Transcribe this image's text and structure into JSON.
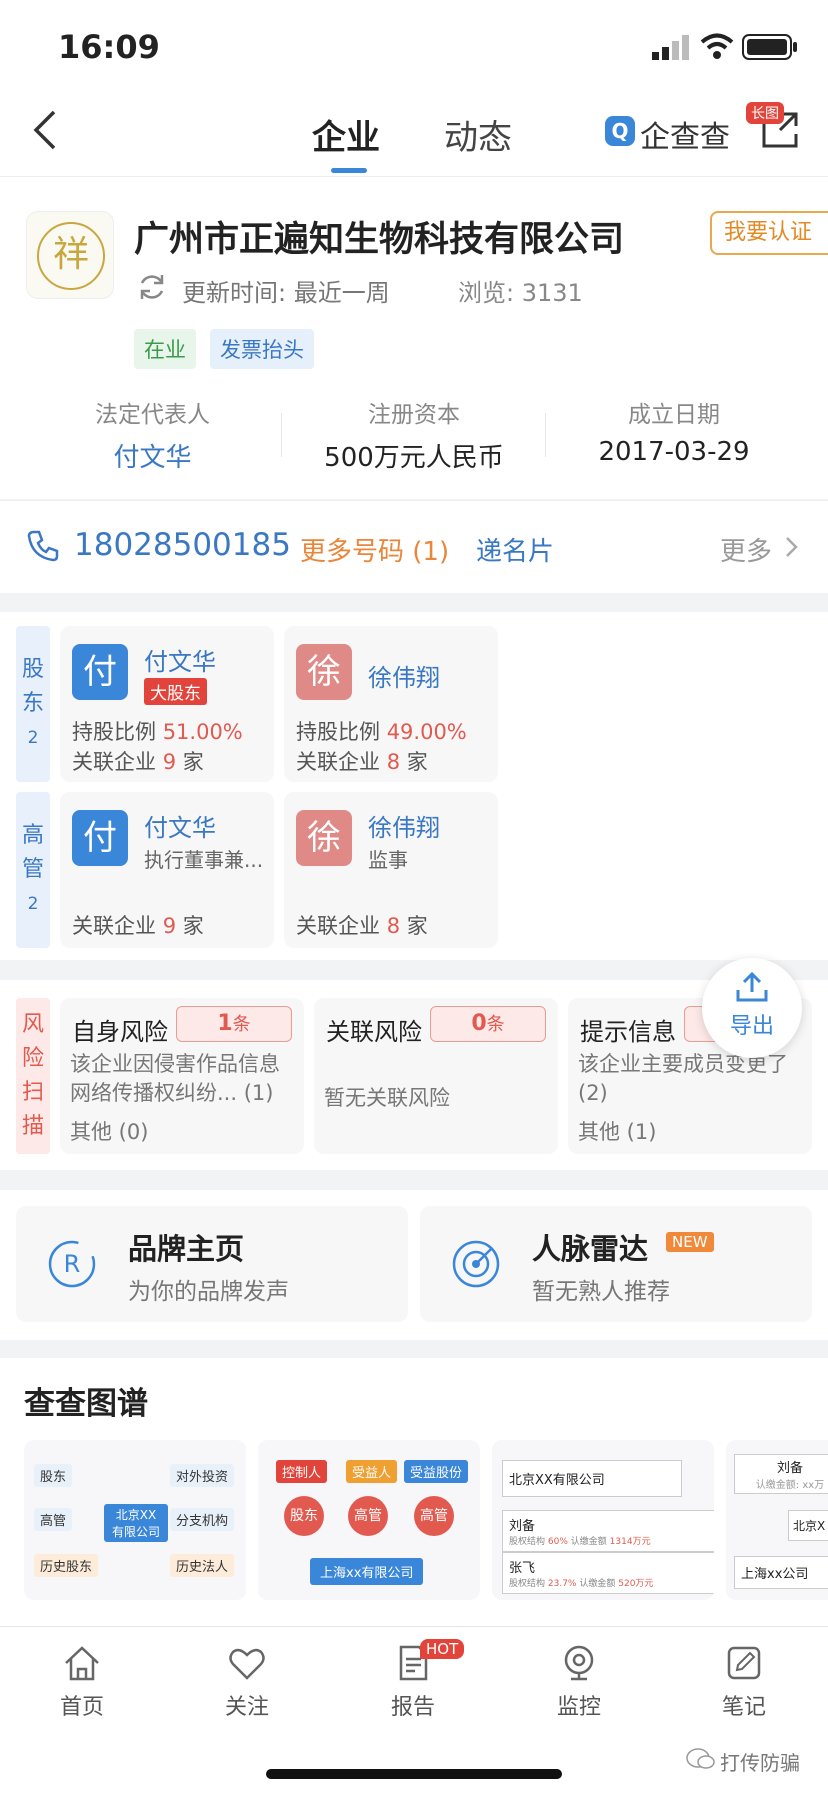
{
  "status_bar": {
    "time": "16:09"
  },
  "header": {
    "tabs": [
      "企业",
      "动态"
    ],
    "active_tab": 0,
    "brand": "企查查",
    "long_image_badge": "长图"
  },
  "company": {
    "logo_char": "祥",
    "name": "广州市正遍知生物科技有限公司",
    "claim_button": "我要认证",
    "update_label": "更新时间: 最近一周",
    "views_label": "浏览: 3131",
    "tags": [
      "在业",
      "发票抬头"
    ],
    "info": [
      {
        "label": "法定代表人",
        "value": "付文华"
      },
      {
        "label": "注册资本",
        "value": "500万元人民币"
      },
      {
        "label": "成立日期",
        "value": "2017-03-29"
      }
    ]
  },
  "contact": {
    "phone": "18028500185",
    "more_numbers": "更多号码 (1)",
    "card": "递名片",
    "more": "更多"
  },
  "shareholders": {
    "side_label": [
      "股",
      "东"
    ],
    "count": "2",
    "items": [
      {
        "avatar": "付",
        "name": "付文华",
        "badge": "大股东",
        "ratio_label": "持股比例",
        "ratio": "51.00%",
        "related_prefix": "关联企业",
        "related_count": "9",
        "related_suffix": "家"
      },
      {
        "avatar": "徐",
        "name": "徐伟翔",
        "ratio_label": "持股比例",
        "ratio": "49.00%",
        "related_prefix": "关联企业",
        "related_count": "8",
        "related_suffix": "家"
      }
    ]
  },
  "executives": {
    "side_label": [
      "高",
      "管"
    ],
    "count": "2",
    "items": [
      {
        "avatar": "付",
        "name": "付文华",
        "role": "执行董事兼...",
        "related_prefix": "关联企业",
        "related_count": "9",
        "related_suffix": "家"
      },
      {
        "avatar": "徐",
        "name": "徐伟翔",
        "role": "监事",
        "related_prefix": "关联企业",
        "related_count": "8",
        "related_suffix": "家"
      }
    ]
  },
  "risk": {
    "side_label": [
      "风",
      "险",
      "扫",
      "描"
    ],
    "export": "导出",
    "cards": [
      {
        "title": "自身风险",
        "count": "1",
        "unit": "条",
        "desc": "该企业因侵害作品信息网络传播权纠纷... (1)",
        "other": "其他 (0)"
      },
      {
        "title": "关联风险",
        "count": "0",
        "unit": "条",
        "desc": "暂无关联风险",
        "other": ""
      },
      {
        "title": "提示信息",
        "count": "",
        "unit": "",
        "desc": "该企业主要成员变更了 (2)",
        "other": "其他 (1)"
      }
    ]
  },
  "features": [
    {
      "title": "品牌主页",
      "subtitle": "为你的品牌发声",
      "badge": ""
    },
    {
      "title": "人脉雷达",
      "subtitle": "暂无熟人推荐",
      "badge": "NEW"
    }
  ],
  "graph": {
    "title": "查查图谱",
    "thumb1": {
      "nodes": [
        "股东",
        "对外投资",
        "高管",
        "分支机构",
        "历史股东",
        "历史法人"
      ],
      "center": "北京XX有限公司"
    },
    "thumb2": {
      "top": [
        "控制人",
        "受益人",
        "受益股份"
      ],
      "circles": [
        "股东",
        "高管",
        "高管"
      ],
      "bottom": "上海xx有限公司"
    },
    "thumb3": {
      "company": "北京XX有限公司",
      "rows": [
        {
          "name": "刘备",
          "ratio_label": "股权结构",
          "ratio": "60%",
          "amount_label": "认缴金额",
          "amount": "1314万元"
        },
        {
          "name": "张飞",
          "ratio_label": "股权结构",
          "ratio": "23.7%",
          "amount_label": "认缴金额",
          "amount": "520万元"
        }
      ]
    },
    "thumb4": {
      "name": "刘备",
      "amount": "认缴金额: xx万",
      "right": "北京X",
      "bottom": "上海xx公司"
    }
  },
  "bottom_nav": {
    "items": [
      "首页",
      "关注",
      "报告",
      "监控",
      "笔记"
    ],
    "hot_badge": "HOT"
  },
  "watermark": "打传防骗"
}
